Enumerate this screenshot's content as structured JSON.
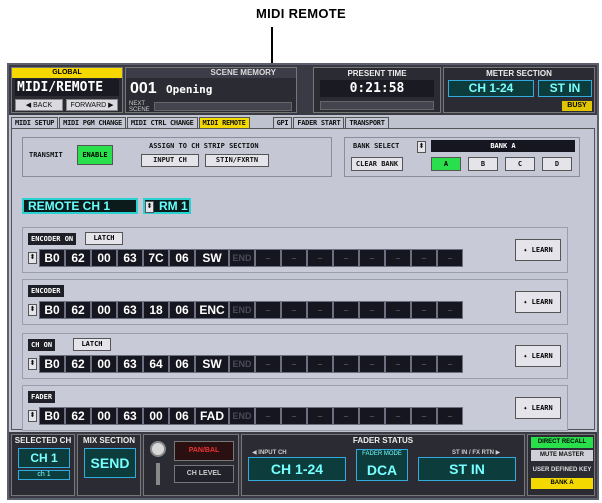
{
  "caption": "MIDI REMOTE",
  "header": {
    "global_label": "GLOBAL",
    "global_title": "MIDI/REMOTE",
    "back_label": "◀ BACK",
    "forward_label": "FORWARD ▶",
    "scene_label": "SCENE MEMORY",
    "scene_number": "001",
    "scene_name": "Opening",
    "next_label": "NEXT SCENE",
    "time_label": "PRESENT TIME",
    "time_value": "0:21:58",
    "meter_label": "METER SECTION",
    "meter_ch": "CH 1-24",
    "meter_st": "ST IN",
    "busy": "BUSY"
  },
  "tabs": [
    "MIDI SETUP",
    "MIDI PGM CHANGE",
    "MIDI CTRL CHANGE",
    "MIDI REMOTE",
    "GPI",
    "FADER START",
    "TRANSPORT"
  ],
  "controls": {
    "transmit_label": "TRANSMIT",
    "enable_label": "ENABLE",
    "assign_title": "ASSIGN TO CH STRIP SECTION",
    "input_ch": "INPUT CH",
    "stin_fxrtn": "STIN/FXRTN",
    "bank_select_label": "BANK SELECT",
    "bank_value": "BANK A",
    "clear_bank": "CLEAR BANK",
    "banks": [
      "A",
      "B",
      "C",
      "D"
    ]
  },
  "remote": {
    "channel": "REMOTE CH 1",
    "rm": "RM 1"
  },
  "rows": [
    {
      "title": "ENCODER ON",
      "latch": "LATCH",
      "bytes": [
        "B0",
        "62",
        "00",
        "63",
        "7C",
        "06",
        "SW"
      ],
      "learn": "✦ LEARN"
    },
    {
      "title": "ENCODER",
      "latch": "",
      "bytes": [
        "B0",
        "62",
        "00",
        "63",
        "18",
        "06",
        "ENC"
      ],
      "learn": "✦ LEARN"
    },
    {
      "title": "CH ON",
      "latch": "LATCH",
      "bytes": [
        "B0",
        "62",
        "00",
        "63",
        "64",
        "06",
        "SW"
      ],
      "learn": "✦ LEARN"
    },
    {
      "title": "FADER",
      "latch": "",
      "bytes": [
        "B0",
        "62",
        "00",
        "63",
        "00",
        "06",
        "FAD"
      ],
      "learn": "✦ LEARN"
    }
  ],
  "end_label": "END",
  "empty_byte": "–",
  "bottom": {
    "selected_ch_label": "SELECTED CH",
    "selected_ch": "CH 1",
    "selected_ch_sub": "ch 1",
    "mix_section_label": "MIX SECTION",
    "mix_send": "SEND",
    "pan_bal": "PAN/BAL",
    "ch_level": "CH LEVEL",
    "fader_status_label": "FADER STATUS",
    "input_ch_label": "◀ INPUT CH",
    "stin_fxrtn_label": "ST IN / FX RTN ▶",
    "fs_input": "CH 1-24",
    "fader_mode_label": "FADER MODE",
    "fader_mode": "DCA",
    "fs_stin": "ST IN",
    "direct_recall": "DIRECT RECALL",
    "mute_master": "MUTE MASTER",
    "user_defined_key": "USER DEFINED KEY",
    "user_bank": "BANK A"
  },
  "colors": {
    "active_tab": "#f3d900",
    "enable_green": "#29e04c",
    "cyan_accent": "#2ad1d1"
  }
}
